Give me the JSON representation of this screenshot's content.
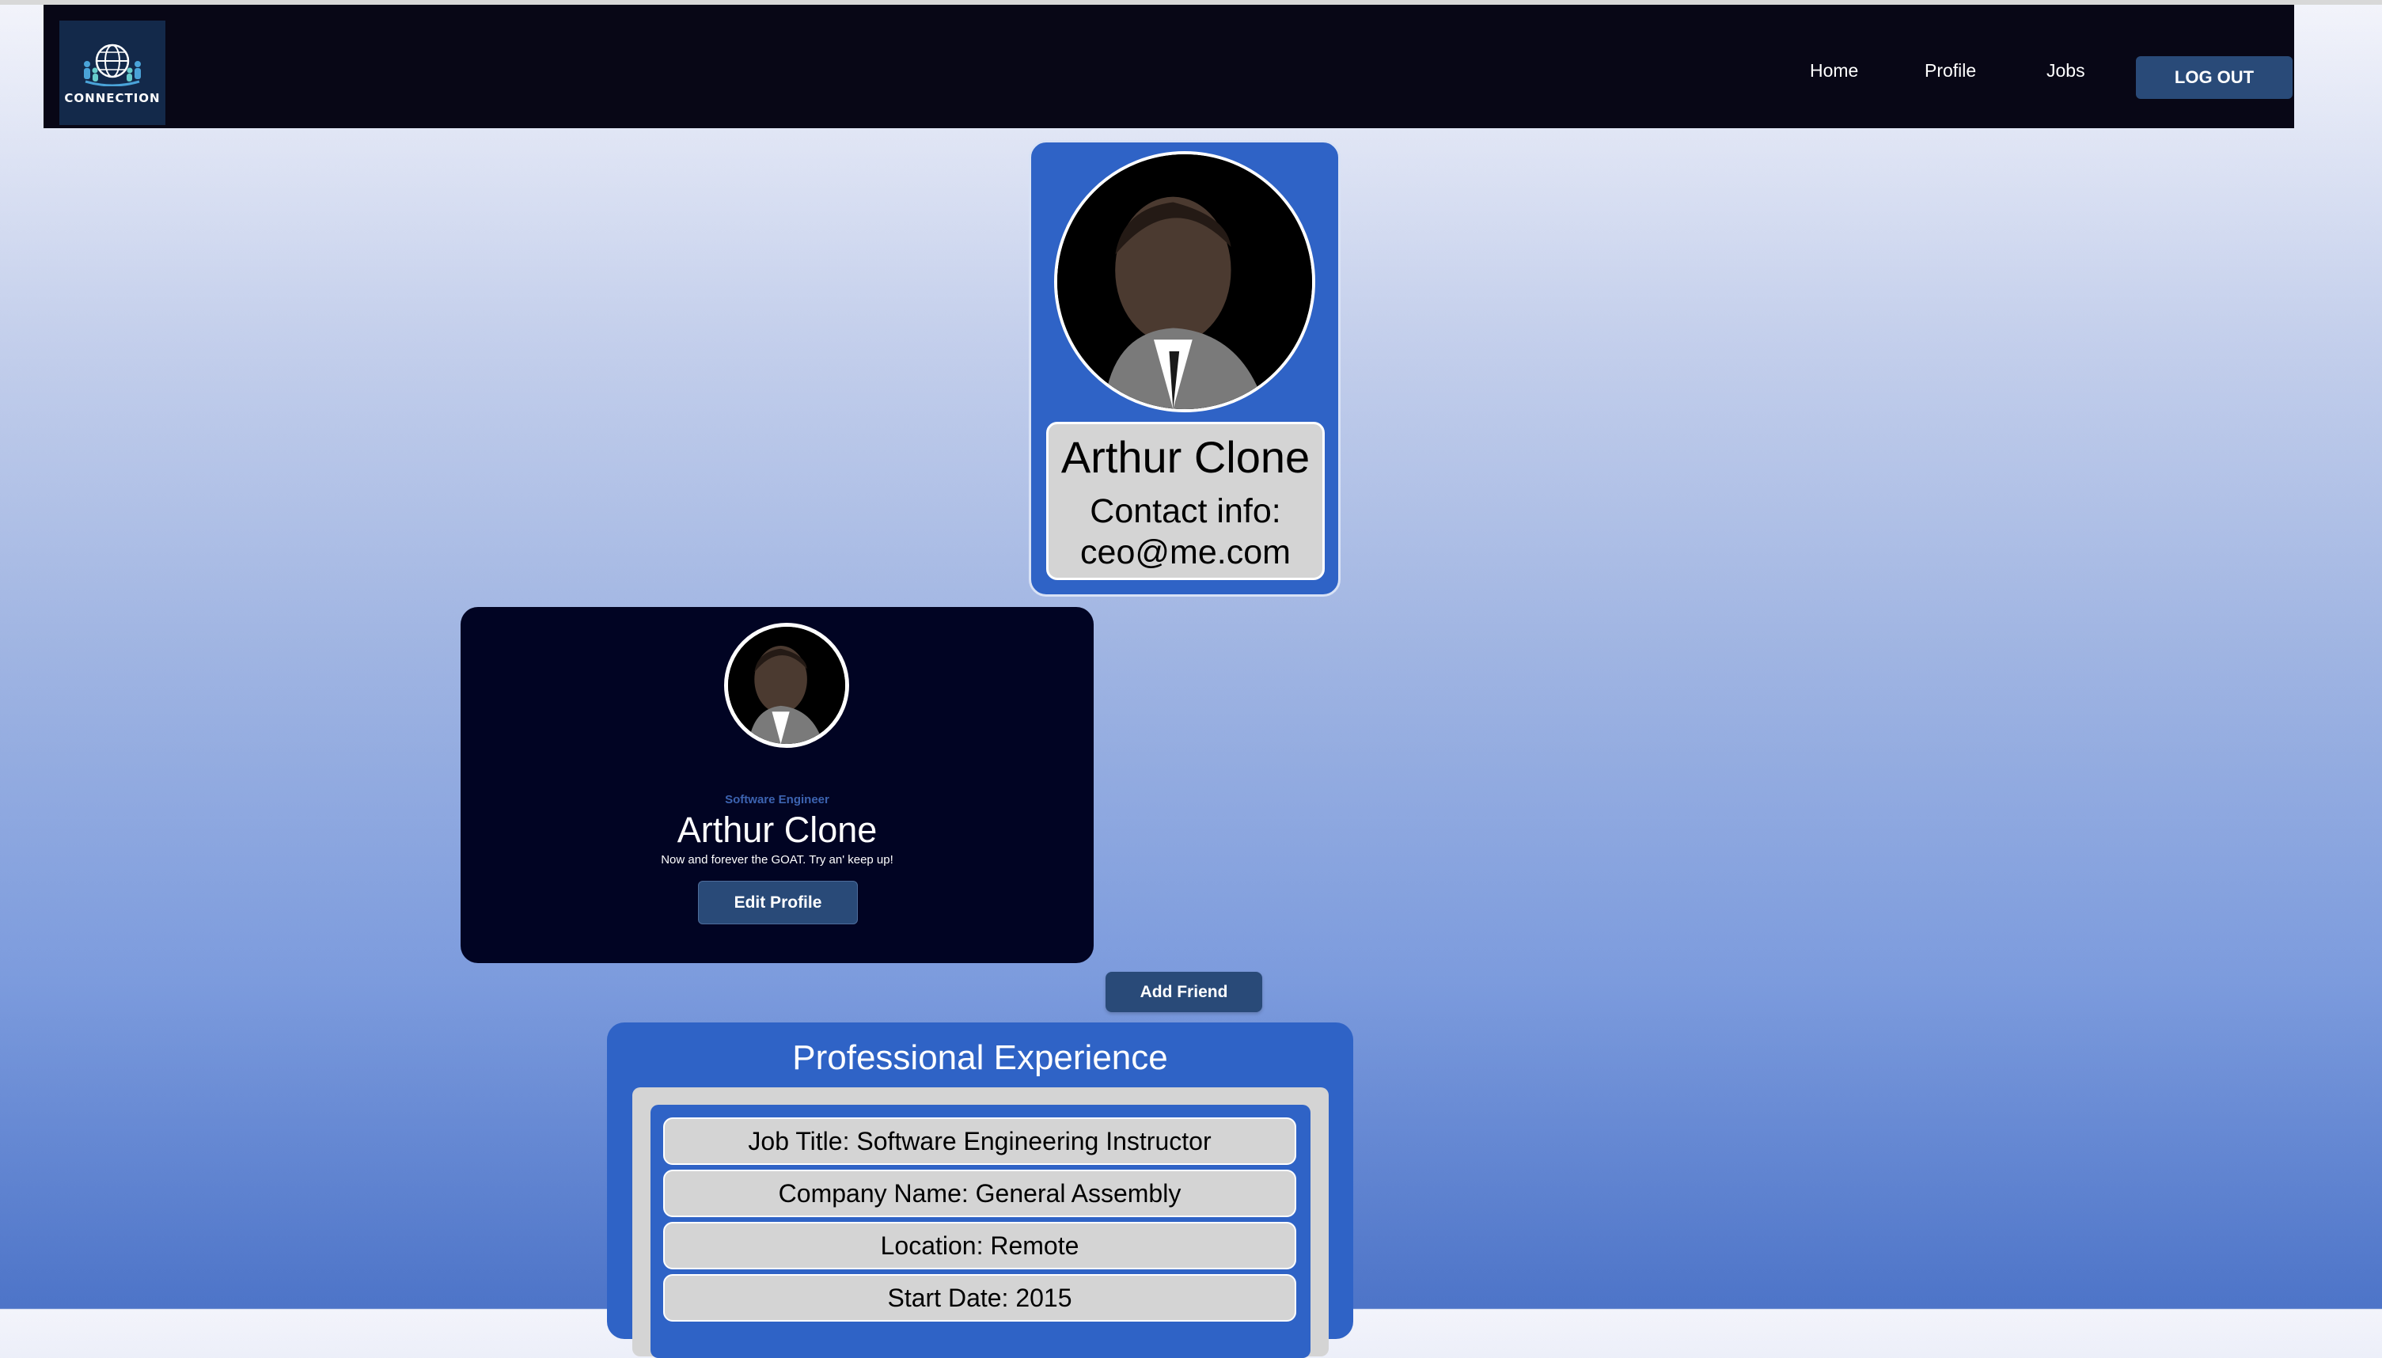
{
  "nav": {
    "logo_text": "CONNECTION",
    "links": [
      "Home",
      "Profile",
      "Jobs"
    ],
    "logout_label": "LOG OUT"
  },
  "profile_card": {
    "name": "Arthur Clone",
    "contact_label": "Contact info:",
    "email": "ceo@me.com"
  },
  "dark_card": {
    "role": "Software Engineer",
    "name": "Arthur Clone",
    "bio": "Now and forever the GOAT. Try an' keep up!",
    "edit_label": "Edit Profile"
  },
  "add_friend_label": "Add Friend",
  "experience": {
    "title": "Professional Experience",
    "rows": [
      "Job Title: Software Engineering Instructor",
      "Company Name: General Assembly",
      "Location: Remote",
      "Start Date: 2015"
    ]
  },
  "colors": {
    "navbar": "#080716",
    "card_blue": "#2f63c6",
    "dark_card": "#010423",
    "button": "#294a78"
  }
}
